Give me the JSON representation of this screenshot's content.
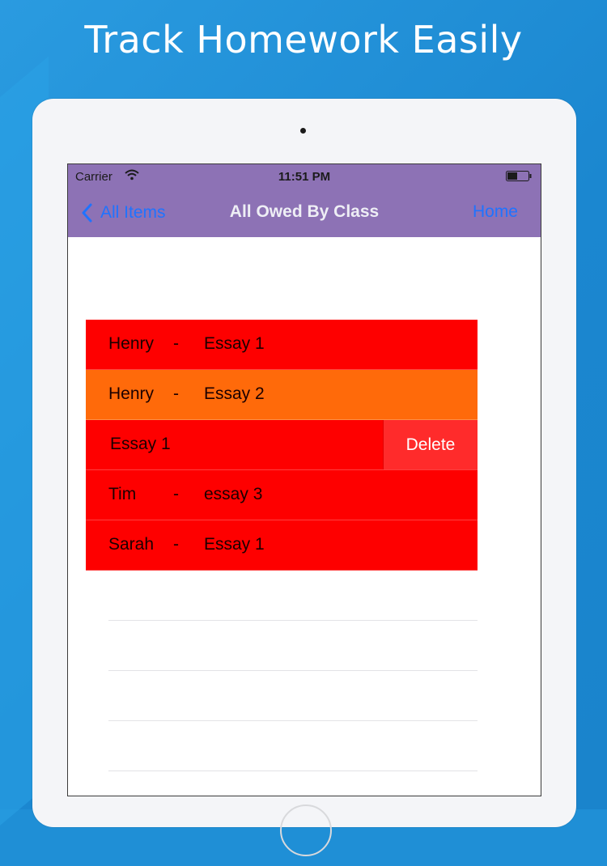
{
  "promo": {
    "headline": "Track Homework Easily"
  },
  "status_bar": {
    "carrier": "Carrier",
    "time": "11:51 PM"
  },
  "nav": {
    "back_label": "All Items",
    "title": "All Owed By Class",
    "home_label": "Home"
  },
  "rows": [
    {
      "name": "Henry",
      "dash": "-",
      "item": "Essay 1",
      "color": "#fe0000"
    },
    {
      "name": "Henry",
      "dash": "-",
      "item": "Essay 2",
      "color": "#ff6a0a"
    },
    {
      "name": "",
      "dash": "",
      "item": "Essay 1",
      "color": "#fe0000",
      "delete_label": "Delete"
    },
    {
      "name": "Tim",
      "dash": "-",
      "item": "essay 3",
      "color": "#fe0000"
    },
    {
      "name": "Sarah",
      "dash": "-",
      "item": "Essay 1",
      "color": "#fe0000"
    }
  ],
  "colors": {
    "nav_bar": "#8d72b5",
    "accent_link": "#1f73ff",
    "row_red": "#fe0000",
    "row_orange": "#ff6a0a",
    "delete": "#ff2b2b",
    "background": "#1f8fd6"
  },
  "icons": {
    "back": "chevron-left-icon",
    "wifi": "wifi-icon",
    "battery": "battery-icon"
  }
}
